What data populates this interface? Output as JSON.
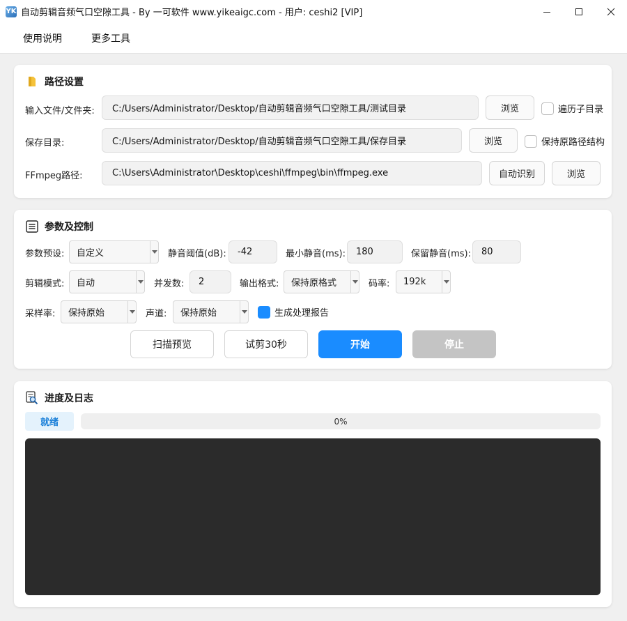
{
  "window": {
    "title": "自动剪辑音频气口空隙工具 - By 一可软件 www.yikeaigc.com - 用户: ceshi2 [VIP]",
    "app_icon_letter": "YK"
  },
  "menu": {
    "items": [
      "使用说明",
      "更多工具"
    ]
  },
  "path_settings": {
    "title": "路径设置",
    "input": {
      "label": "输入文件/文件夹:",
      "value": "C:/Users/Administrator/Desktop/自动剪辑音频气口空隙工具/测试目录",
      "browse": "浏览",
      "recursive_label": "遍历子目录",
      "recursive_checked": false
    },
    "save": {
      "label": "保存目录:",
      "value": "C:/Users/Administrator/Desktop/自动剪辑音频气口空隙工具/保存目录",
      "browse": "浏览",
      "keep_structure_label": "保持原路径结构",
      "keep_structure_checked": false
    },
    "ffmpeg": {
      "label": "FFmpeg路径:",
      "value": "C:\\Users\\Administrator\\Desktop\\ceshi\\ffmpeg\\bin\\ffmpeg.exe",
      "auto_detect": "自动识别",
      "browse": "浏览"
    }
  },
  "params": {
    "title": "参数及控制",
    "preset": {
      "label": "参数预设:",
      "value": "自定义"
    },
    "silence_threshold": {
      "label": "静音阈值(dB):",
      "value": "-42"
    },
    "min_silence": {
      "label": "最小静音(ms):",
      "value": "180"
    },
    "keep_silence": {
      "label": "保留静音(ms):",
      "value": "80"
    },
    "edit_mode": {
      "label": "剪辑模式:",
      "value": "自动"
    },
    "concurrency": {
      "label": "并发数:",
      "value": "2"
    },
    "output_format": {
      "label": "输出格式:",
      "value": "保持原格式"
    },
    "bitrate": {
      "label": "码率:",
      "value": "192k"
    },
    "sample_rate": {
      "label": "采样率:",
      "value": "保持原始"
    },
    "channels": {
      "label": "声道:",
      "value": "保持原始"
    },
    "report": {
      "label": "生成处理报告",
      "checked": true
    },
    "buttons": {
      "scan": "扫描预览",
      "trial": "试剪30秒",
      "start": "开始",
      "stop": "停止"
    },
    "colors": {
      "start": "#1a8cff",
      "stop_disabled": "#c4c4c4"
    }
  },
  "progress_log": {
    "title": "进度及日志",
    "status": "就绪",
    "progress_text": "0%",
    "progress_fraction": 0,
    "log_background": "#2b2b2b"
  }
}
